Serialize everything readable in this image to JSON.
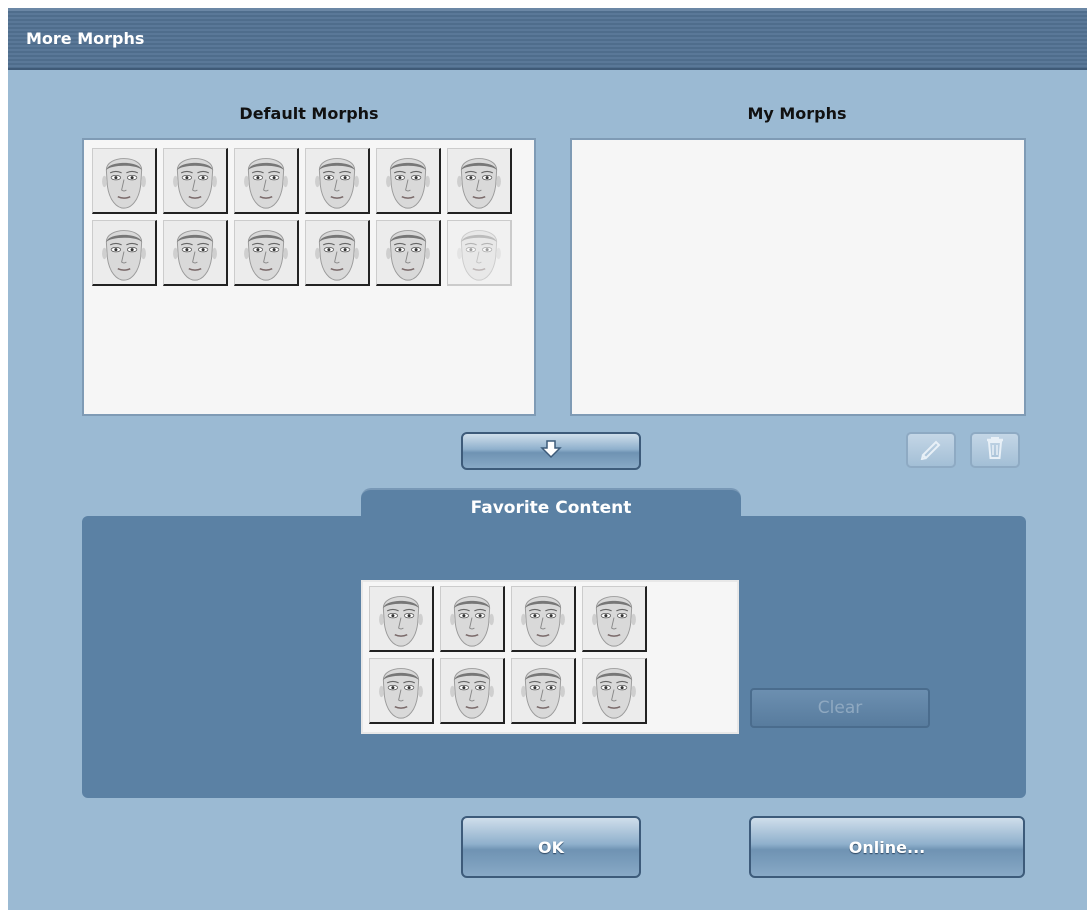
{
  "window": {
    "title": "More Morphs"
  },
  "default_morphs": {
    "label": "Default Morphs",
    "items": [
      "morph-1",
      "morph-2",
      "morph-3",
      "morph-4",
      "morph-5",
      "morph-6",
      "morph-7",
      "morph-8",
      "morph-9",
      "morph-10",
      "morph-11",
      "morph-12-disabled"
    ]
  },
  "my_morphs": {
    "label": "My Morphs",
    "items": []
  },
  "toolbar": {
    "add_icon": "arrow-down-icon",
    "edit_icon": "pencil-icon",
    "delete_icon": "trash-icon"
  },
  "favorite": {
    "label": "Favorite Content",
    "items": [
      "fav-1",
      "fav-2",
      "fav-3",
      "fav-4",
      "fav-5",
      "fav-6",
      "fav-7",
      "fav-8"
    ],
    "clear_label": "Clear"
  },
  "footer": {
    "ok_label": "OK",
    "online_label": "Online..."
  },
  "colors": {
    "window_bg": "#9bbad3",
    "titlebar": "#4f6d8c",
    "favorite_bg": "#5b81a4"
  }
}
